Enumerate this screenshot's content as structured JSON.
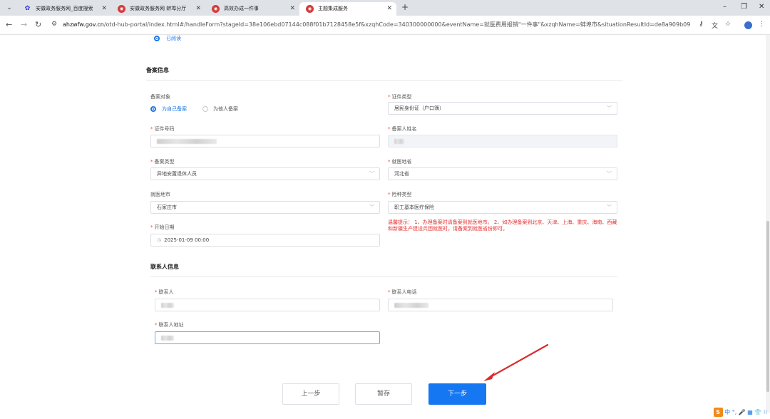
{
  "browser": {
    "tabs": [
      {
        "label": "安徽政务服务网_百度搜索",
        "icon": "baidu-paw-icon",
        "active": false
      },
      {
        "label": "安徽政务服务网 蚌埠分厅",
        "icon": "gov-logo-icon",
        "active": false
      },
      {
        "label": "高效办成一件事",
        "icon": "gov-logo-icon",
        "active": false
      },
      {
        "label": "主题集成服务",
        "icon": "gov-logo-icon",
        "active": true
      }
    ],
    "url_domain": "ahzwfw.gov.cn",
    "url_rest": "/otd-hub-portal/index.html#/handleForm?stageId=38e106ebd07144c088f01b7128458e5f&xzqhCode=340300000000&eventName=就医费用报销\"一件事\"&xzqhName=蚌埠市&situationResultId=de8a909b098b425c900..."
  },
  "read_status": {
    "label": "已阅读"
  },
  "filing_section": {
    "title": "备案信息",
    "target_label": "备案对象",
    "target_options": [
      {
        "label": "为自己备案",
        "checked": true
      },
      {
        "label": "为他人备案",
        "checked": false
      }
    ],
    "id_type": {
      "label": "证件类型",
      "value": "居民身份证（户口簿）"
    },
    "id_number": {
      "label": "证件号码"
    },
    "filer_name": {
      "label": "备案人姓名"
    },
    "filing_type": {
      "label": "备案类型",
      "value": "异地安置退休人员"
    },
    "province": {
      "label": "就医地省",
      "value": "河北省"
    },
    "city": {
      "label": "就医地市",
      "value": "石家庄市"
    },
    "insurance_type": {
      "label": "险种类型",
      "value": "职工基本医疗保险"
    },
    "start_date": {
      "label": "开始日期",
      "value": "2025-01-09 00:00"
    },
    "tip": "温馨提示：  1、办理备案时请备案到就医地市。  2、如办理备案到北京、天津、上海、重庆、海南、西藏和新疆生产建设兵团就医时，请备案到就医省份即可。"
  },
  "contact_section": {
    "title": "联系人信息",
    "contact": {
      "label": "联系人"
    },
    "phone": {
      "label": "联系人电话"
    },
    "address": {
      "label": "联系人地址"
    }
  },
  "actions": {
    "prev": "上一步",
    "save": "暂存",
    "next": "下一步"
  },
  "ime": {
    "text": "中 °, 🎤 ▦ 👕 ⁝⁝"
  },
  "colors": {
    "primary": "#1677f2",
    "required": "#f04040",
    "tip": "#e53030",
    "annotation_arrow": "#e02a2a"
  }
}
